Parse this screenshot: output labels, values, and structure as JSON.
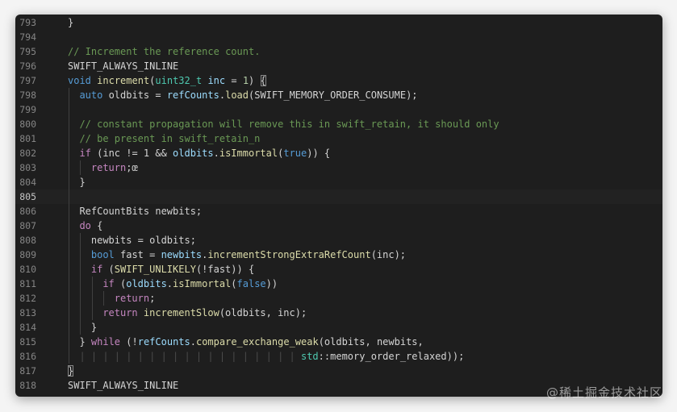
{
  "editor": {
    "current_line": "805",
    "lines": [
      {
        "n": "793",
        "indent": 1,
        "tokens": [
          [
            "}",
            "plain"
          ]
        ]
      },
      {
        "n": "794",
        "indent": 1,
        "tokens": []
      },
      {
        "n": "795",
        "indent": 1,
        "tokens": [
          [
            "// Increment the reference count.",
            "comment"
          ]
        ]
      },
      {
        "n": "796",
        "indent": 1,
        "tokens": [
          [
            "SWIFT_ALWAYS_INLINE",
            "plain"
          ]
        ]
      },
      {
        "n": "797",
        "indent": 1,
        "tokens": [
          [
            "void",
            "keyword"
          ],
          [
            " ",
            "plain"
          ],
          [
            "increment",
            "func"
          ],
          [
            "(",
            "plain"
          ],
          [
            "uint32_t",
            "type"
          ],
          [
            " ",
            "plain"
          ],
          [
            "inc",
            "var"
          ],
          [
            " = ",
            "plain"
          ],
          [
            "1",
            "num"
          ],
          [
            ") ",
            "plain"
          ],
          [
            "{",
            "bracket"
          ]
        ]
      },
      {
        "n": "798",
        "indent": 2,
        "tokens": [
          [
            "auto",
            "keyword"
          ],
          [
            " oldbits = ",
            "plain"
          ],
          [
            "refCounts",
            "var"
          ],
          [
            ".",
            "plain"
          ],
          [
            "load",
            "func"
          ],
          [
            "(SWIFT_MEMORY_ORDER_CONSUME);",
            "plain"
          ]
        ]
      },
      {
        "n": "799",
        "indent": 2,
        "tokens": []
      },
      {
        "n": "800",
        "indent": 2,
        "tokens": [
          [
            "// constant propagation will remove this in swift_retain, it should only",
            "comment"
          ]
        ]
      },
      {
        "n": "801",
        "indent": 2,
        "tokens": [
          [
            "// be present in swift_retain_n",
            "comment"
          ]
        ]
      },
      {
        "n": "802",
        "indent": 2,
        "tokens": [
          [
            "if",
            "control"
          ],
          [
            " (inc != 1 && ",
            "plain"
          ],
          [
            "oldbits",
            "var"
          ],
          [
            ".",
            "plain"
          ],
          [
            "isImmortal",
            "func"
          ],
          [
            "(",
            "plain"
          ],
          [
            "true",
            "keyword"
          ],
          [
            ")) {",
            "plain"
          ]
        ]
      },
      {
        "n": "803",
        "indent": 3,
        "tokens": [
          [
            "return",
            "control"
          ],
          [
            ";œ",
            "plain"
          ]
        ]
      },
      {
        "n": "804",
        "indent": 2,
        "tokens": [
          [
            "}",
            "plain"
          ]
        ]
      },
      {
        "n": "805",
        "indent": 2,
        "tokens": []
      },
      {
        "n": "806",
        "indent": 2,
        "tokens": [
          [
            "RefCountBits newbits;",
            "plain"
          ]
        ]
      },
      {
        "n": "807",
        "indent": 2,
        "tokens": [
          [
            "do",
            "control"
          ],
          [
            " {",
            "plain"
          ]
        ]
      },
      {
        "n": "808",
        "indent": 3,
        "tokens": [
          [
            "newbits = oldbits;",
            "plain"
          ]
        ]
      },
      {
        "n": "809",
        "indent": 3,
        "tokens": [
          [
            "bool",
            "keyword"
          ],
          [
            " fast = ",
            "plain"
          ],
          [
            "newbits",
            "var"
          ],
          [
            ".",
            "plain"
          ],
          [
            "incrementStrongExtraRefCount",
            "func"
          ],
          [
            "(inc);",
            "plain"
          ]
        ]
      },
      {
        "n": "810",
        "indent": 3,
        "tokens": [
          [
            "if",
            "control"
          ],
          [
            " (",
            "plain"
          ],
          [
            "SWIFT_UNLIKELY",
            "func"
          ],
          [
            "(!fast)) {",
            "plain"
          ]
        ]
      },
      {
        "n": "811",
        "indent": 4,
        "tokens": [
          [
            "if",
            "control"
          ],
          [
            " (",
            "plain"
          ],
          [
            "oldbits",
            "var"
          ],
          [
            ".",
            "plain"
          ],
          [
            "isImmortal",
            "func"
          ],
          [
            "(",
            "plain"
          ],
          [
            "false",
            "keyword"
          ],
          [
            "))",
            "plain"
          ]
        ]
      },
      {
        "n": "812",
        "indent": 5,
        "tokens": [
          [
            "return",
            "control"
          ],
          [
            ";",
            "plain"
          ]
        ]
      },
      {
        "n": "813",
        "indent": 4,
        "tokens": [
          [
            "return",
            "control"
          ],
          [
            " ",
            "plain"
          ],
          [
            "incrementSlow",
            "func"
          ],
          [
            "(oldbits, inc);",
            "plain"
          ]
        ]
      },
      {
        "n": "814",
        "indent": 3,
        "tokens": [
          [
            "}",
            "plain"
          ]
        ]
      },
      {
        "n": "815",
        "indent": 2,
        "tokens": [
          [
            "}",
            "plain"
          ],
          [
            " while",
            "control"
          ],
          [
            " (!",
            "plain"
          ],
          [
            "refCounts",
            "var"
          ],
          [
            ".",
            "plain"
          ],
          [
            "compare_exchange_weak",
            "func"
          ],
          [
            "(oldbits, newbits,",
            "plain"
          ]
        ]
      },
      {
        "n": "816",
        "indent": 2,
        "tokens": [
          [
            "| | | | | | | | | | | | | | | | | | | ",
            "dots"
          ],
          [
            "std",
            "type"
          ],
          [
            "::memory_order_relaxed));",
            "plain"
          ]
        ]
      },
      {
        "n": "817",
        "indent": 1,
        "tokens": [
          [
            "}",
            "bracket"
          ]
        ]
      },
      {
        "n": "818",
        "indent": 1,
        "tokens": [
          [
            "SWIFT_ALWAYS_INLINE",
            "plain"
          ]
        ]
      }
    ]
  },
  "watermark": "@稀土掘金技术社区"
}
